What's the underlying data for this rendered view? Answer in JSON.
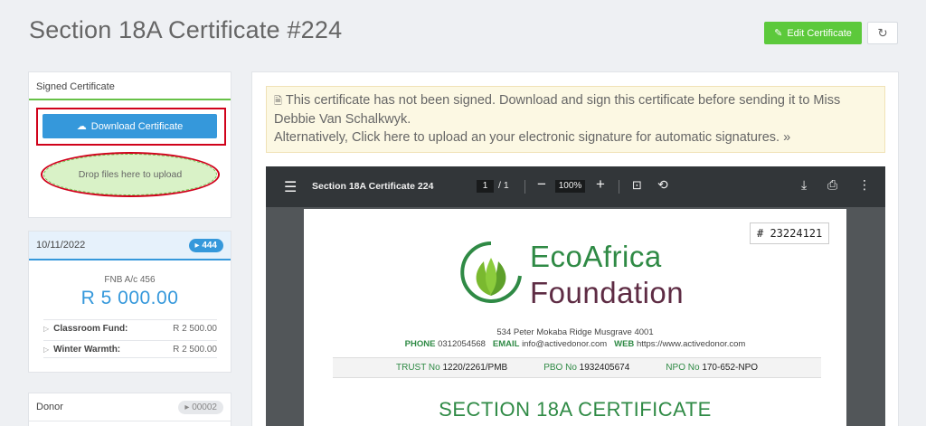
{
  "page": {
    "title": "Section 18A Certificate #224",
    "edit_label": "Edit Certificate"
  },
  "signed_card": {
    "heading": "Signed Certificate",
    "download_label": "Download Certificate",
    "dropzone_label": "Drop files here to upload"
  },
  "donation_card": {
    "date": "10/11/2022",
    "badge": "444",
    "bank": "FNB A/c 456",
    "amount": "R 5 000.00",
    "funds": [
      {
        "label": "Classroom Fund:",
        "value": "R 2 500.00"
      },
      {
        "label": "Winter Warmth:",
        "value": "R 2 500.00"
      }
    ]
  },
  "donor_card": {
    "heading": "Donor",
    "badge": "00002"
  },
  "alert": {
    "line1": "This certificate has not been signed. Download and sign this certificate before sending it to Miss Debbie Van Schalkwyk.",
    "line2": "Alternatively, Click here to upload an your electronic signature for automatic signatures. »"
  },
  "viewer": {
    "doc_title": "Section 18A Certificate 224",
    "page_current": "1",
    "page_total": "/ 1",
    "zoom": "100%"
  },
  "certificate": {
    "number": "# 23224121",
    "org_line1": "EcoAfrica",
    "org_line2": "Foundation",
    "address": "534 Peter Mokaba Ridge Musgrave 4001",
    "phone_label": "PHONE",
    "phone": "0312054568",
    "email_label": "EMAIL",
    "email": "info@activedonor.com",
    "web_label": "WEB",
    "web": "https://www.activedonor.com",
    "trust_label": "TRUST No",
    "trust": "1220/2261/PMB",
    "pbo_label": "PBO No",
    "pbo": "1932405674",
    "npo_label": "NPO No",
    "npo": "170-652-NPO",
    "heading": "SECTION 18A CERTIFICATE"
  },
  "colors": {
    "accent_green": "#5cc93b",
    "accent_blue": "#3598db",
    "highlight_red": "#d0021b",
    "brand_green": "#2f8a45",
    "brand_plum": "#5e2c44"
  }
}
